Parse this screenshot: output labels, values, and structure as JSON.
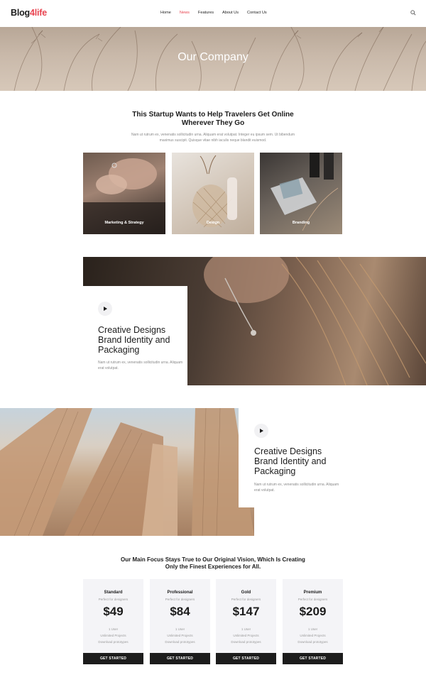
{
  "header": {
    "logo_part1": "Blog",
    "logo_part2": "4life",
    "nav": [
      {
        "label": "Home"
      },
      {
        "label": "News"
      },
      {
        "label": "Features"
      },
      {
        "label": "About Us"
      },
      {
        "label": "Contact Us"
      }
    ]
  },
  "hero": {
    "title": "Our Company"
  },
  "intro": {
    "title": "This Startup Wants to Help Travelers Get Online Wherever They Go",
    "text": "Nam ut rutrum ex, venenatis sollicitudin urna. Aliquam erat volutpat. Integer eu ipsum sem. Ut bibendum maximus suscipit. Quisque vitae nibh iaculis neque blandit euismod."
  },
  "cards": [
    {
      "label": "Marketing & Strategy"
    },
    {
      "label": "Design"
    },
    {
      "label": "Branding"
    }
  ],
  "feature1": {
    "title": "Creative Designs Brand Identity and Packaging",
    "text": "Nam ut rutrum ex, venenatis sollicitudin urna. Aliquam erat volutpat."
  },
  "feature2": {
    "title": "Creative Designs Brand Identity and Packaging",
    "text": "Nam ut rutrum ex, venenatis sollicitudin urna. Aliquam erat volutpat."
  },
  "pricing": {
    "title": "Our Main Focus Stays True to Our Original Vision, Which Is Creating Only the Finest Experiences for All.",
    "plans": [
      {
        "name": "Standard",
        "sub": "Perfect for designers",
        "price": "$49",
        "f1": "1 User",
        "f2": "Unlimited Projects",
        "f3": "Download prototypes",
        "button": "GET STARTED"
      },
      {
        "name": "Professional",
        "sub": "Perfect for designers",
        "price": "$84",
        "f1": "1 User",
        "f2": "Unlimited Projects",
        "f3": "Download prototypes",
        "button": "GET STARTED"
      },
      {
        "name": "Gold",
        "sub": "Perfect for designers",
        "price": "$147",
        "f1": "1 User",
        "f2": "Unlimited Projects",
        "f3": "Download prototypes",
        "button": "GET STARTED"
      },
      {
        "name": "Premium",
        "sub": "Perfect for designers",
        "price": "$209",
        "f1": "1 User",
        "f2": "Unlimited Projects",
        "f3": "Download prototypes",
        "button": "GET STARTED"
      }
    ]
  },
  "colors": {
    "accent": "#e8434f",
    "dark": "#1c1c1c",
    "muted": "#8a8a8a",
    "plan_bg": "#f4f4f7"
  },
  "icons": {
    "search": "search-icon",
    "play": "play-icon"
  }
}
